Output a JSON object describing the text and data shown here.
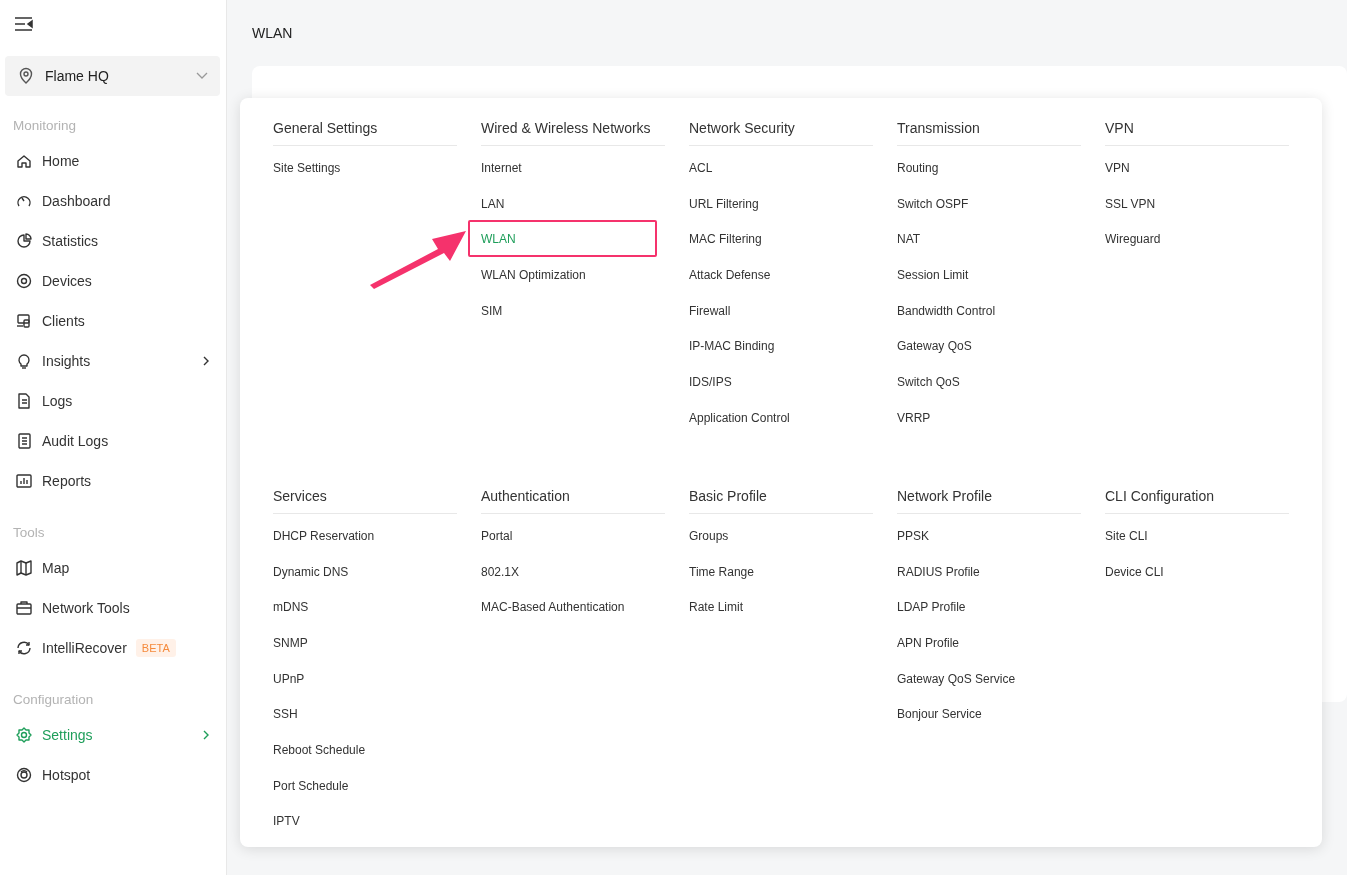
{
  "sidebar": {
    "site": "Flame HQ",
    "sections": [
      {
        "title": "Monitoring",
        "items": [
          {
            "label": "Home",
            "selected": false,
            "expandable": false
          },
          {
            "label": "Dashboard",
            "selected": false,
            "expandable": false
          },
          {
            "label": "Statistics",
            "selected": false,
            "expandable": false
          },
          {
            "label": "Devices",
            "selected": false,
            "expandable": false
          },
          {
            "label": "Clients",
            "selected": false,
            "expandable": false
          },
          {
            "label": "Insights",
            "selected": false,
            "expandable": true
          },
          {
            "label": "Logs",
            "selected": false,
            "expandable": false
          },
          {
            "label": "Audit Logs",
            "selected": false,
            "expandable": false
          },
          {
            "label": "Reports",
            "selected": false,
            "expandable": false
          }
        ]
      },
      {
        "title": "Tools",
        "items": [
          {
            "label": "Map",
            "selected": false,
            "expandable": false
          },
          {
            "label": "Network Tools",
            "selected": false,
            "expandable": false
          },
          {
            "label": "IntelliRecover",
            "selected": false,
            "expandable": false,
            "badge": "BETA"
          }
        ]
      },
      {
        "title": "Configuration",
        "items": [
          {
            "label": "Settings",
            "selected": true,
            "expandable": true
          },
          {
            "label": "Hotspot",
            "selected": false,
            "expandable": false
          }
        ]
      }
    ]
  },
  "page": {
    "title": "WLAN"
  },
  "menu": {
    "groups": [
      {
        "title": "General Settings",
        "items": [
          {
            "label": "Site Settings",
            "selected": false,
            "highlighted": false
          }
        ]
      },
      {
        "title": "Wired & Wireless Networks",
        "items": [
          {
            "label": "Internet",
            "selected": false,
            "highlighted": false
          },
          {
            "label": "LAN",
            "selected": false,
            "highlighted": false
          },
          {
            "label": "WLAN",
            "selected": true,
            "highlighted": true
          },
          {
            "label": "WLAN Optimization",
            "selected": false,
            "highlighted": false
          },
          {
            "label": "SIM",
            "selected": false,
            "highlighted": false
          }
        ]
      },
      {
        "title": "Network Security",
        "items": [
          {
            "label": "ACL",
            "selected": false,
            "highlighted": false
          },
          {
            "label": "URL Filtering",
            "selected": false,
            "highlighted": false
          },
          {
            "label": "MAC Filtering",
            "selected": false,
            "highlighted": false
          },
          {
            "label": "Attack Defense",
            "selected": false,
            "highlighted": false
          },
          {
            "label": "Firewall",
            "selected": false,
            "highlighted": false
          },
          {
            "label": "IP-MAC Binding",
            "selected": false,
            "highlighted": false
          },
          {
            "label": "IDS/IPS",
            "selected": false,
            "highlighted": false
          },
          {
            "label": "Application Control",
            "selected": false,
            "highlighted": false
          }
        ]
      },
      {
        "title": "Transmission",
        "items": [
          {
            "label": "Routing",
            "selected": false,
            "highlighted": false
          },
          {
            "label": "Switch OSPF",
            "selected": false,
            "highlighted": false
          },
          {
            "label": "NAT",
            "selected": false,
            "highlighted": false
          },
          {
            "label": "Session Limit",
            "selected": false,
            "highlighted": false
          },
          {
            "label": "Bandwidth Control",
            "selected": false,
            "highlighted": false
          },
          {
            "label": "Gateway QoS",
            "selected": false,
            "highlighted": false
          },
          {
            "label": "Switch QoS",
            "selected": false,
            "highlighted": false
          },
          {
            "label": "VRRP",
            "selected": false,
            "highlighted": false
          }
        ]
      },
      {
        "title": "VPN",
        "items": [
          {
            "label": "VPN",
            "selected": false,
            "highlighted": false
          },
          {
            "label": "SSL VPN",
            "selected": false,
            "highlighted": false
          },
          {
            "label": "Wireguard",
            "selected": false,
            "highlighted": false
          }
        ]
      },
      {
        "title": "Services",
        "items": [
          {
            "label": "DHCP Reservation",
            "selected": false,
            "highlighted": false
          },
          {
            "label": "Dynamic DNS",
            "selected": false,
            "highlighted": false
          },
          {
            "label": "mDNS",
            "selected": false,
            "highlighted": false
          },
          {
            "label": "SNMP",
            "selected": false,
            "highlighted": false
          },
          {
            "label": "UPnP",
            "selected": false,
            "highlighted": false
          },
          {
            "label": "SSH",
            "selected": false,
            "highlighted": false
          },
          {
            "label": "Reboot Schedule",
            "selected": false,
            "highlighted": false
          },
          {
            "label": "Port Schedule",
            "selected": false,
            "highlighted": false
          },
          {
            "label": "IPTV",
            "selected": false,
            "highlighted": false
          }
        ]
      },
      {
        "title": "Authentication",
        "items": [
          {
            "label": "Portal",
            "selected": false,
            "highlighted": false
          },
          {
            "label": "802.1X",
            "selected": false,
            "highlighted": false
          },
          {
            "label": "MAC-Based Authentication",
            "selected": false,
            "highlighted": false
          }
        ]
      },
      {
        "title": "Basic Profile",
        "items": [
          {
            "label": "Groups",
            "selected": false,
            "highlighted": false
          },
          {
            "label": "Time Range",
            "selected": false,
            "highlighted": false
          },
          {
            "label": "Rate Limit",
            "selected": false,
            "highlighted": false
          }
        ]
      },
      {
        "title": "Network Profile",
        "items": [
          {
            "label": "PPSK",
            "selected": false,
            "highlighted": false
          },
          {
            "label": "RADIUS Profile",
            "selected": false,
            "highlighted": false
          },
          {
            "label": "LDAP Profile",
            "selected": false,
            "highlighted": false
          },
          {
            "label": "APN Profile",
            "selected": false,
            "highlighted": false
          },
          {
            "label": "Gateway QoS Service",
            "selected": false,
            "highlighted": false
          },
          {
            "label": "Bonjour Service",
            "selected": false,
            "highlighted": false
          }
        ]
      },
      {
        "title": "CLI Configuration",
        "items": [
          {
            "label": "Site CLI",
            "selected": false,
            "highlighted": false
          },
          {
            "label": "Device CLI",
            "selected": false,
            "highlighted": false
          }
        ]
      }
    ]
  }
}
